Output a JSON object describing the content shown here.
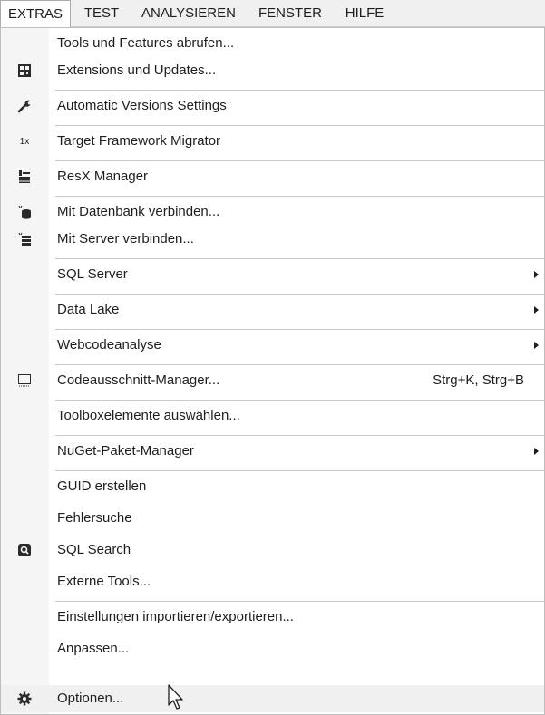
{
  "menubar": {
    "items": [
      {
        "label": "EXTRAS",
        "active": true
      },
      {
        "label": "TEST",
        "active": false
      },
      {
        "label": "ANALYSIEREN",
        "active": false
      },
      {
        "label": "FENSTER",
        "active": false
      },
      {
        "label": "HILFE",
        "active": false
      }
    ]
  },
  "menu": {
    "items": [
      {
        "label": "Tools und Features abrufen...",
        "icon": null
      },
      {
        "label": "Extensions und Updates...",
        "icon": "extensions-icon"
      },
      {
        "label": "Automatic Versions Settings",
        "icon": "wrench-icon"
      },
      {
        "label": "Target Framework Migrator",
        "icon": "migrator-icon",
        "icon_text": "1x"
      },
      {
        "label": "ResX Manager",
        "icon": "resx-icon"
      },
      {
        "label": "Mit Datenbank verbinden...",
        "icon": "database-connect-icon"
      },
      {
        "label": "Mit Server verbinden...",
        "icon": "server-connect-icon"
      },
      {
        "label": "SQL Server",
        "icon": null,
        "submenu": true
      },
      {
        "label": "Data Lake",
        "icon": null,
        "submenu": true
      },
      {
        "label": "Webcodeanalyse",
        "icon": null,
        "submenu": true
      },
      {
        "label": "Codeausschnitt-Manager...",
        "icon": "snippet-icon",
        "shortcut": "Strg+K, Strg+B"
      },
      {
        "label": "Toolboxelemente auswählen...",
        "icon": null
      },
      {
        "label": "NuGet-Paket-Manager",
        "icon": null,
        "submenu": true
      },
      {
        "label": "GUID erstellen",
        "icon": null
      },
      {
        "label": "Fehlersuche",
        "icon": null
      },
      {
        "label": "SQL Search",
        "icon": "sql-search-icon"
      },
      {
        "label": "Externe Tools...",
        "icon": null
      },
      {
        "label": "Einstellungen importieren/exportieren...",
        "icon": null
      },
      {
        "label": "Anpassen...",
        "icon": null
      },
      {
        "label": "Optionen...",
        "icon": "gear-icon",
        "hover": true
      }
    ]
  },
  "colors": {
    "menubar_bg": "#f0f0f0",
    "gutter_bg": "#f5f5f5",
    "separator": "#c8c8c8",
    "hover_bg": "#f0f0f0",
    "text": "#1e1e1e"
  }
}
